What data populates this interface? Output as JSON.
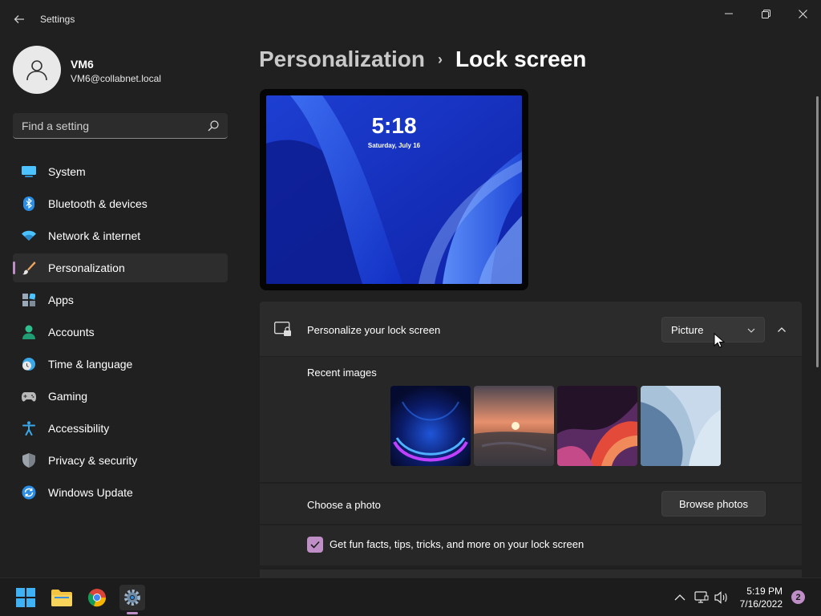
{
  "window": {
    "title": "Settings"
  },
  "user": {
    "name": "VM6",
    "email": "VM6@collabnet.local"
  },
  "search": {
    "placeholder": "Find a setting"
  },
  "sidebar": {
    "items": [
      {
        "label": "System",
        "icon": "monitor-icon",
        "active": false
      },
      {
        "label": "Bluetooth & devices",
        "icon": "bluetooth-icon",
        "active": false
      },
      {
        "label": "Network & internet",
        "icon": "wifi-icon",
        "active": false
      },
      {
        "label": "Personalization",
        "icon": "paintbrush-icon",
        "active": true
      },
      {
        "label": "Apps",
        "icon": "apps-icon",
        "active": false
      },
      {
        "label": "Accounts",
        "icon": "person-icon",
        "active": false
      },
      {
        "label": "Time & language",
        "icon": "globe-clock-icon",
        "active": false
      },
      {
        "label": "Gaming",
        "icon": "gamepad-icon",
        "active": false
      },
      {
        "label": "Accessibility",
        "icon": "accessibility-icon",
        "active": false
      },
      {
        "label": "Privacy & security",
        "icon": "shield-icon",
        "active": false
      },
      {
        "label": "Windows Update",
        "icon": "update-icon",
        "active": false
      }
    ]
  },
  "breadcrumb": {
    "parent": "Personalization",
    "separator": "›",
    "current": "Lock screen"
  },
  "preview": {
    "time": "5:18",
    "date": "Saturday, July 16"
  },
  "lock_card": {
    "title": "Personalize your lock screen",
    "dropdown_value": "Picture",
    "recent_label": "Recent images",
    "recent_images": [
      "blue-bloom-thumbnail",
      "sunset-lake-thumbnail",
      "purple-ribbon-thumbnail",
      "light-blue-bloom-thumbnail"
    ],
    "choose_label": "Choose a photo",
    "browse_button": "Browse photos",
    "tips_label": "Get fun facts, tips, tricks, and more on your lock screen",
    "tips_checked": true
  },
  "taskbar": {
    "time": "5:19 PM",
    "date": "7/16/2022",
    "notification_count": "2"
  },
  "colors": {
    "accent": "#c08ec7",
    "background": "#202020",
    "card": "#2b2b2b"
  }
}
